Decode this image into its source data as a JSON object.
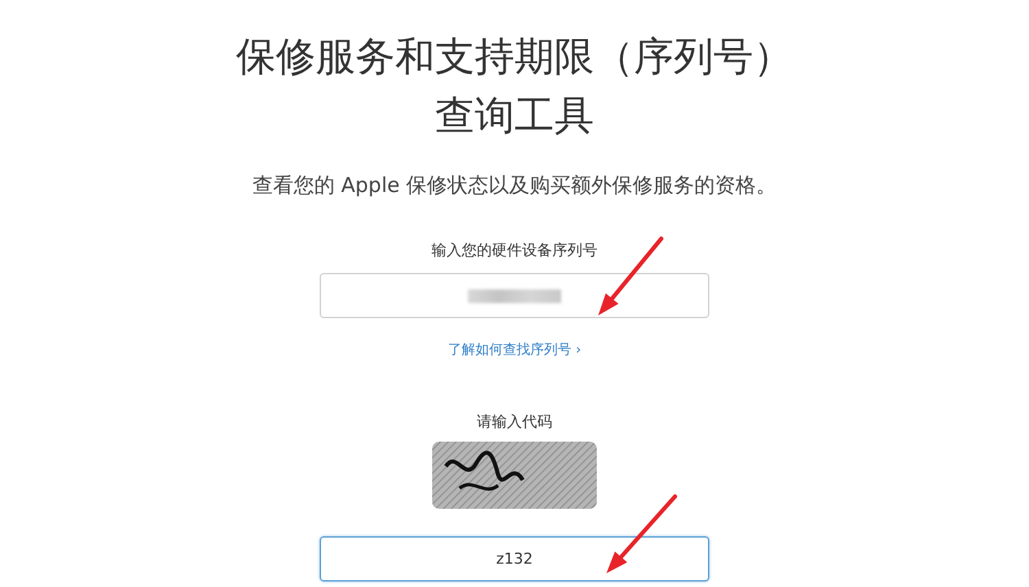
{
  "title_lines": [
    "保修服务和支持期限（序列号）",
    "查询工具"
  ],
  "subtitle": "查看您的 Apple 保修状态以及购买额外保修服务的资格。",
  "serial": {
    "label": "输入您的硬件设备序列号",
    "value_masked": true,
    "focused": false
  },
  "help_link": "了解如何查找序列号 ›",
  "captcha": {
    "label": "请输入代码",
    "value": "z132",
    "focused": true
  }
}
